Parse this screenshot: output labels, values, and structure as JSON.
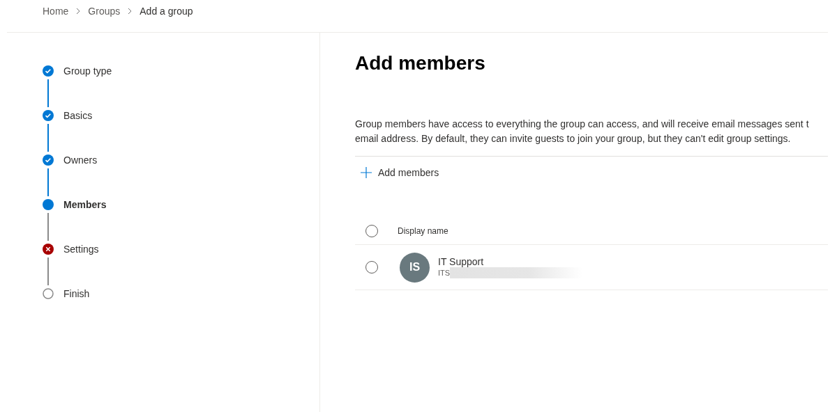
{
  "breadcrumb": [
    "Home",
    "Groups",
    "Add a group"
  ],
  "steps": [
    {
      "label": "Group type",
      "kind": "done"
    },
    {
      "label": "Basics",
      "kind": "done"
    },
    {
      "label": "Owners",
      "kind": "done"
    },
    {
      "label": "Members",
      "kind": "current"
    },
    {
      "label": "Settings",
      "kind": "error"
    },
    {
      "label": "Finish",
      "kind": "pending"
    }
  ],
  "heading": "Add members",
  "description_lines": [
    "Group members have access to everything the group can access, and will receive email messages sent t",
    "email address. By default, they can invite guests to join your group, but they can't edit group settings."
  ],
  "add_button": "Add members",
  "table": {
    "columns": [
      "Display name"
    ],
    "select_all": false,
    "rows": [
      {
        "initials": "IS",
        "name": "IT Support",
        "email": "ITS",
        "selected": false
      }
    ]
  }
}
